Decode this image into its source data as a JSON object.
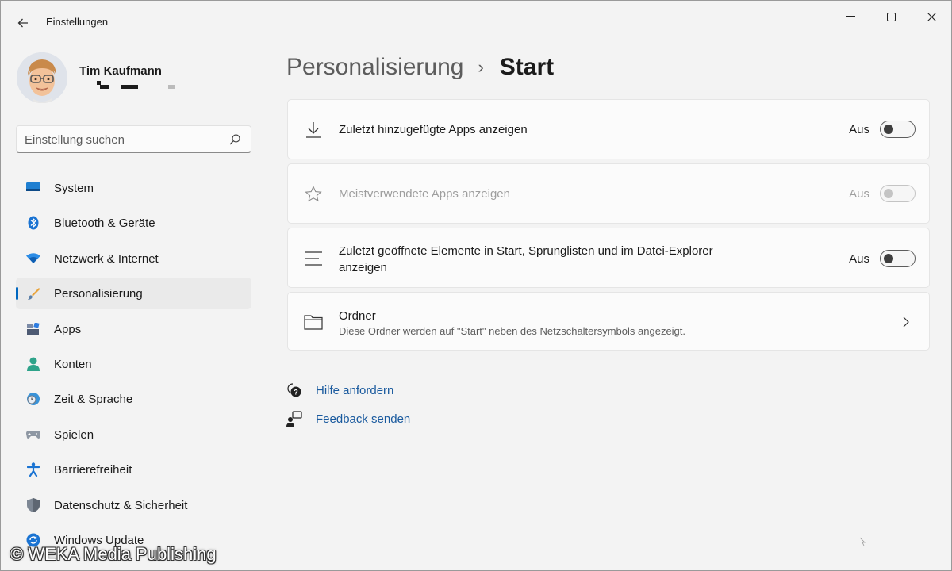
{
  "window": {
    "title": "Einstellungen"
  },
  "profile": {
    "name": "Tim Kaufmann"
  },
  "search": {
    "placeholder": "Einstellung suchen"
  },
  "nav": {
    "items": [
      {
        "label": "System",
        "icon": "monitor-icon"
      },
      {
        "label": "Bluetooth & Geräte",
        "icon": "bluetooth-icon"
      },
      {
        "label": "Netzwerk & Internet",
        "icon": "wifi-icon"
      },
      {
        "label": "Personalisierung",
        "icon": "brush-icon",
        "active": true
      },
      {
        "label": "Apps",
        "icon": "apps-icon"
      },
      {
        "label": "Konten",
        "icon": "person-icon"
      },
      {
        "label": "Zeit & Sprache",
        "icon": "clock-globe-icon"
      },
      {
        "label": "Spielen",
        "icon": "gamepad-icon"
      },
      {
        "label": "Barrierefreiheit",
        "icon": "accessibility-icon"
      },
      {
        "label": "Datenschutz & Sicherheit",
        "icon": "shield-icon"
      },
      {
        "label": "Windows Update",
        "icon": "update-icon"
      }
    ]
  },
  "breadcrumb": {
    "parent": "Personalisierung",
    "separator": "›",
    "current": "Start"
  },
  "settings": {
    "recent_apps": {
      "title": "Zuletzt hinzugefügte Apps anzeigen",
      "state": "Aus",
      "enabled": true
    },
    "most_used": {
      "title": "Meistverwendete Apps anzeigen",
      "state": "Aus",
      "enabled": false
    },
    "recent_items": {
      "title_line1": "Zuletzt geöffnete Elemente in Start, Sprunglisten und im Datei-Explorer",
      "title_line2": "anzeigen",
      "state": "Aus",
      "enabled": true
    },
    "folders": {
      "title": "Ordner",
      "description": "Diese Ordner werden auf \"Start\" neben des Netzschaltersymbols angezeigt."
    }
  },
  "links": {
    "help": "Hilfe anfordern",
    "feedback": "Feedback senden"
  },
  "watermark": "© WEKA Media Publishing",
  "colors": {
    "accent": "#0067c0",
    "link": "#1a5a9e"
  }
}
